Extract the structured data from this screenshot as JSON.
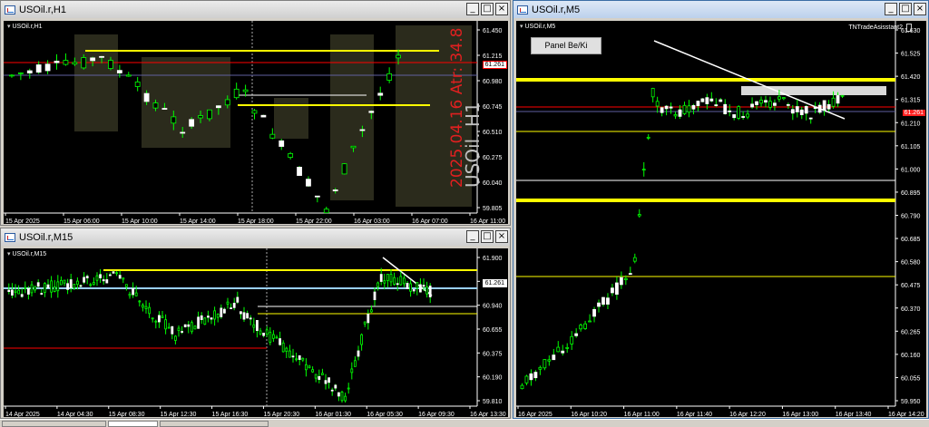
{
  "windows": {
    "h1": {
      "title": "USOil.r,H1",
      "chart_label": "USOil.r,H1",
      "last_price": "61.261",
      "watermark_date": "2025.04.16 Atr: 34.8",
      "watermark_symbol": "USOil. H1",
      "price_ticks": [
        "61.450",
        "61.215",
        "60.980",
        "60.745",
        "60.510",
        "60.275",
        "60.040",
        "59.805"
      ],
      "time_ticks": [
        "15 Apr 2025",
        "15 Apr 06:00",
        "15 Apr 10:00",
        "15 Apr 14:00",
        "15 Apr 18:00",
        "15 Apr 22:00",
        "16 Apr 03:00",
        "16 Apr 07:00",
        "16 Apr 11:00"
      ]
    },
    "m15": {
      "title": "USOil.r,M15",
      "chart_label": "USOil.r,M15",
      "last_price": "61.261",
      "price_ticks": [
        "61.900",
        "61.420",
        "60.940",
        "60.655",
        "60.375",
        "60.190",
        "59.810"
      ],
      "time_ticks": [
        "14 Apr 2025",
        "14 Apr 04:30",
        "15 Apr 08:30",
        "15 Apr 12:30",
        "15 Apr 16:30",
        "15 Apr 20:30",
        "16 Apr 01:30",
        "16 Apr 05:30",
        "16 Apr 09:30",
        "16 Apr 13:30"
      ]
    },
    "m5": {
      "title": "USOil.r,M5",
      "chart_label": "USOil.r,M5",
      "last_price": "61.261",
      "panel_button": "Panel Be/Ki",
      "indicator_label": "TNTradeAsisstant2",
      "price_ticks": [
        "61.630",
        "61.525",
        "61.420",
        "61.315",
        "61.210",
        "61.105",
        "61.000",
        "60.895",
        "60.790",
        "60.685",
        "60.580",
        "60.475",
        "60.370",
        "60.265",
        "60.160",
        "60.055",
        "59.950"
      ],
      "time_ticks": [
        "16 Apr 2025",
        "16 Apr 10:20",
        "16 Apr 11:00",
        "16 Apr 11:40",
        "16 Apr 12:20",
        "16 Apr 13:00",
        "16 Apr 13:40",
        "16 Apr 14:20"
      ]
    }
  },
  "buttons": {
    "minimize": "_",
    "maximize": "□",
    "close": "×"
  },
  "colors": {
    "bull": "#ffffff",
    "bear": "#00ff00",
    "bg": "#000000",
    "grid_text": "#ffffff",
    "yellow_level": "#ffff00",
    "red_level": "#ff0000"
  },
  "icons": {
    "window_icon": "chart-window-icon"
  }
}
